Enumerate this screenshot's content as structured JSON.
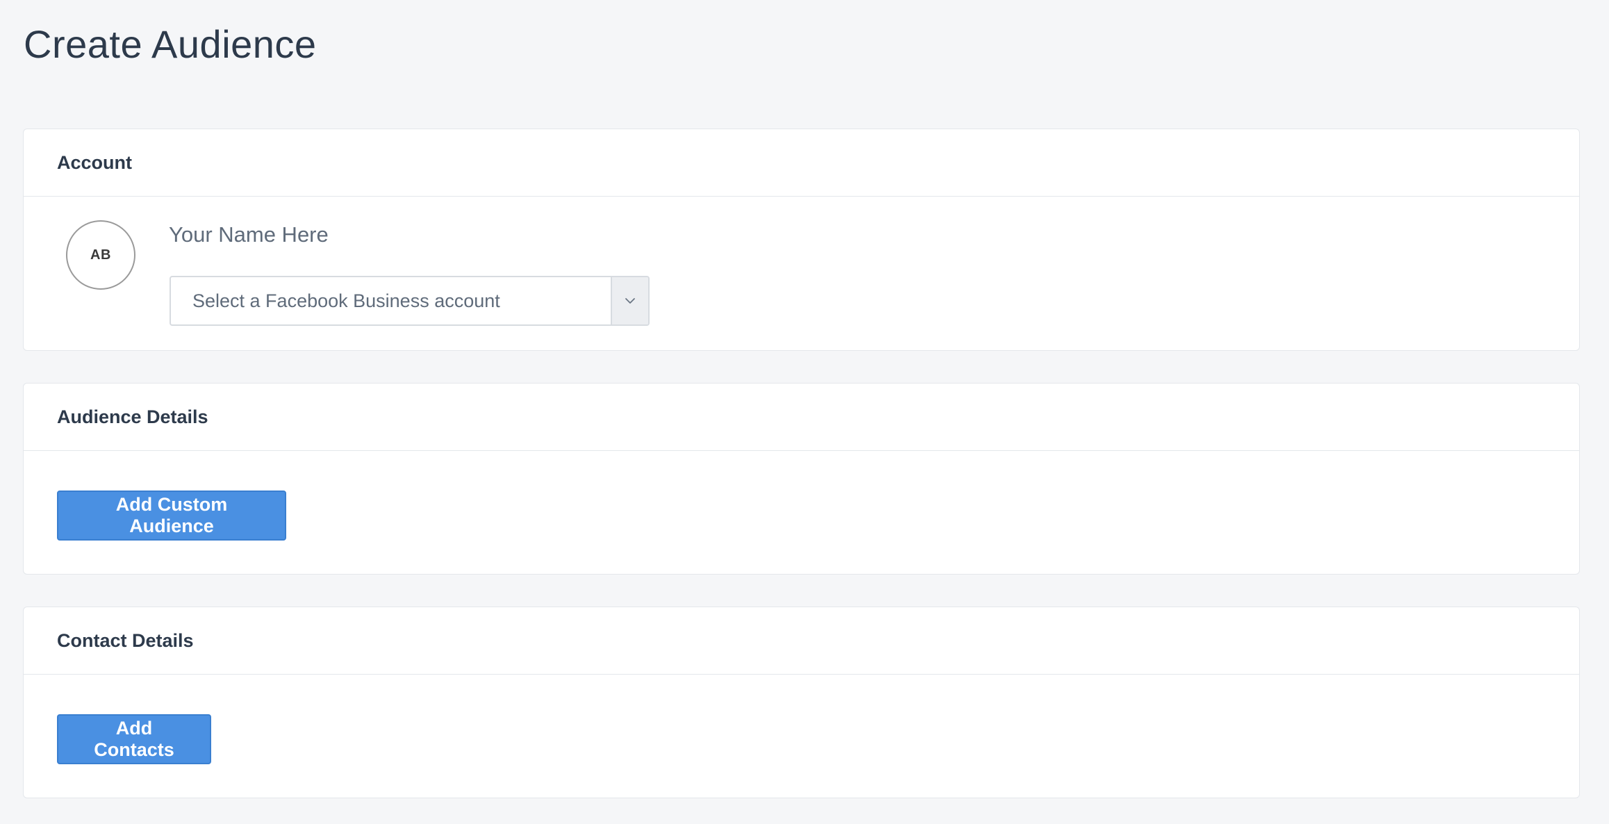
{
  "page": {
    "title": "Create Audience"
  },
  "account": {
    "header": "Account",
    "avatar_initials": "AB",
    "name": "Your Name Here",
    "business_select": {
      "placeholder": "Select a Facebook Business account",
      "icon": "chevron-down-icon"
    }
  },
  "audience_details": {
    "header": "Audience Details",
    "add_button_label": "Add Custom Audience"
  },
  "contact_details": {
    "header": "Contact Details",
    "add_button_label": "Add Contacts"
  },
  "colors": {
    "background": "#f5f6f8",
    "primary_button": "#4a90e2",
    "text_dark": "#2d3a4b",
    "text_muted": "#5f6b7a"
  }
}
